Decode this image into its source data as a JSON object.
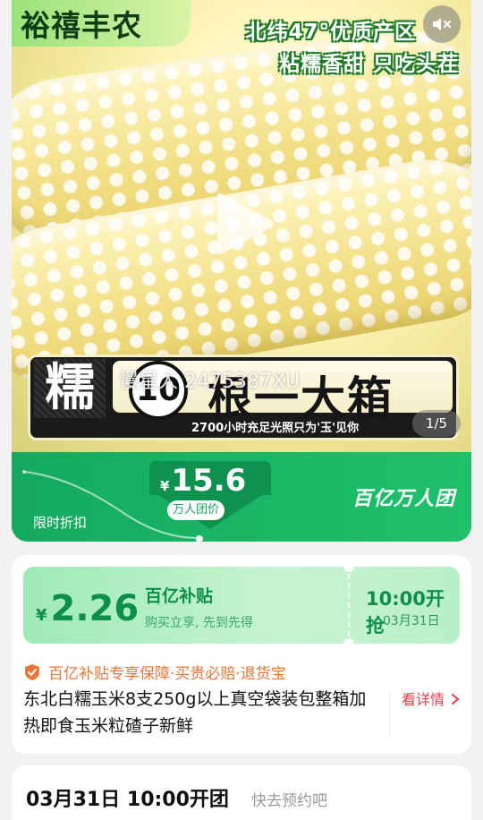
{
  "media": {
    "brand_text": "裕禧丰农",
    "slogan_line1": "北纬47°优质产区",
    "slogan_line2": "粘糯香甜 只吃头茬",
    "banner_char": "糯",
    "banner_number": "10",
    "banner_main": "根一大箱",
    "banner_sub": "2700小时充足光照只为'玉'见你",
    "watermark": "慢星人 2475387XU",
    "page_counter": "1/5"
  },
  "price_strip": {
    "limited_label": "限时折扣",
    "currency": "¥",
    "price": "15.6",
    "price_tag": "万人团价",
    "brand_group": "百亿万人团"
  },
  "subsidy": {
    "currency": "¥",
    "price": "2.26",
    "title": "百亿补贴",
    "desc": "购买立享, 先到先得",
    "sale_time": "10:00开抢",
    "sale_date": "03月31日"
  },
  "guarantee": "百亿补贴专享保障·买贵必赔·退货宝",
  "product_title": "东北白糯玉米8支250g以上真空袋装包整箱加热即食玉米粒碴子新鲜",
  "detail_link": "看详情",
  "reserve": {
    "main": "03月31日 10:00开团",
    "hint": "快去预约吧"
  },
  "colors": {
    "accent_green": "#14a95f",
    "price_green": "#0d8f47",
    "guarantee_orange": "#e8763a",
    "detail_red": "#e83a4a"
  },
  "icons": [
    "mute-icon",
    "play-icon",
    "shield-icon",
    "chevron-right-icon"
  ]
}
